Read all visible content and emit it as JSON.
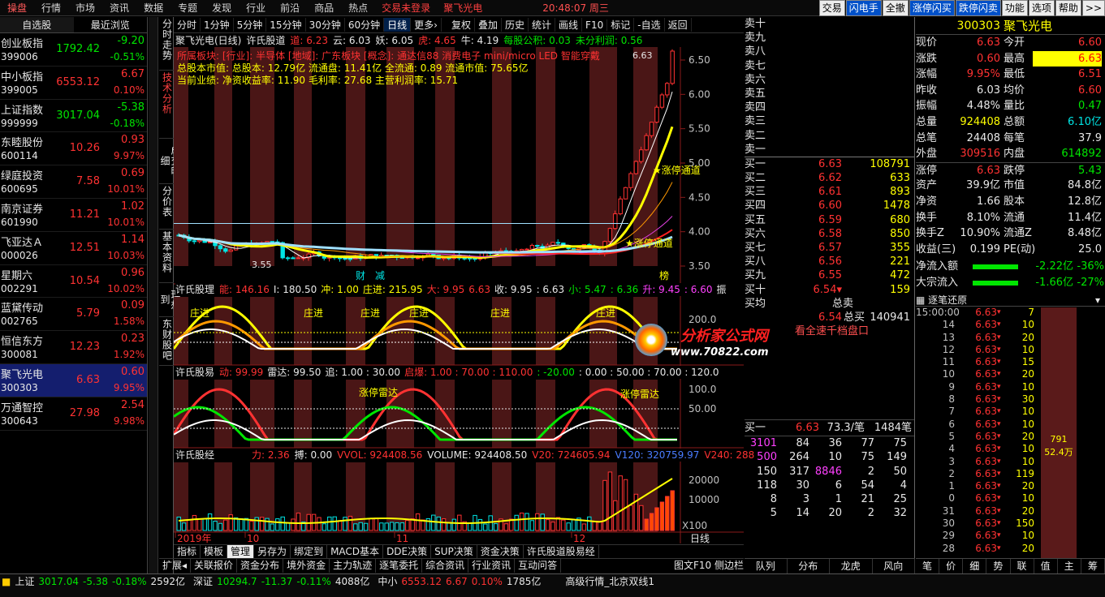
{
  "menu": {
    "items": [
      "操盘",
      "行情",
      "市场",
      "资讯",
      "数据",
      "专题",
      "发现",
      "行业",
      "前沿",
      "商品",
      "热点"
    ],
    "warning": "交易未登录",
    "stock": "聚飞光电",
    "time": "20:48:07 周三",
    "buttons": [
      "交易",
      "闪电手",
      "全撤",
      "涨停闪买",
      "跌停闪卖",
      "功能",
      "选项",
      "帮助",
      ">>"
    ]
  },
  "watch": {
    "tabs": [
      "自选股",
      "最近浏览"
    ],
    "rows": [
      {
        "name": "创业板指",
        "code": "399006",
        "price": "1792.42",
        "chg": "-9.20",
        "pct": "-0.51%",
        "dir": "down"
      },
      {
        "name": "中小板指",
        "code": "399005",
        "price": "6553.12",
        "chg": "6.67",
        "pct": "0.10%",
        "dir": "up"
      },
      {
        "name": "上证指数",
        "code": "999999",
        "price": "3017.04",
        "chg": "-5.38",
        "pct": "-0.18%",
        "dir": "down"
      },
      {
        "name": "东睦股份",
        "code": "600114",
        "price": "10.26",
        "chg": "0.93",
        "pct": "9.97%",
        "dir": "up"
      },
      {
        "name": "绿庭投资",
        "code": "600695",
        "price": "7.58",
        "chg": "0.69",
        "pct": "10.01%",
        "dir": "up"
      },
      {
        "name": "南京证券",
        "code": "601990",
        "price": "11.21",
        "chg": "1.02",
        "pct": "10.01%",
        "dir": "up"
      },
      {
        "name": "飞亚达Ａ",
        "code": "000026",
        "price": "12.51",
        "chg": "1.14",
        "pct": "10.03%",
        "dir": "up"
      },
      {
        "name": "星期六",
        "code": "002291",
        "price": "10.54",
        "chg": "0.96",
        "pct": "10.02%",
        "dir": "up"
      },
      {
        "name": "蓝黛传动",
        "code": "002765",
        "price": "5.79",
        "chg": "0.09",
        "pct": "1.58%",
        "dir": "up"
      },
      {
        "name": "恒信东方",
        "code": "300081",
        "price": "12.23",
        "chg": "0.23",
        "pct": "1.92%",
        "dir": "up"
      },
      {
        "name": "聚飞光电",
        "code": "300303",
        "price": "6.63",
        "chg": "0.60",
        "pct": "9.95%",
        "dir": "up",
        "selected": true
      },
      {
        "name": "万通智控",
        "code": "300643",
        "price": "27.98",
        "chg": "2.54",
        "pct": "9.98%",
        "dir": "up"
      }
    ]
  },
  "vtabs": [
    "分时走势",
    "技术分析",
    "成交明细",
    "分价表",
    "基本资料",
    "理想到",
    "东财股吧"
  ],
  "period": {
    "items": [
      "分时",
      "1分钟",
      "5分钟",
      "15分钟",
      "30分钟",
      "60分钟",
      "日线",
      "更多›"
    ],
    "tools": [
      "复权",
      "叠加",
      "历史",
      "统计",
      "画线",
      "F10",
      "标记",
      "-自选",
      "返回"
    ]
  },
  "kline": {
    "title": "聚飞光电(日线)",
    "indicator": "许氏股道",
    "params": [
      {
        "t": "道: 6.23",
        "c": "red"
      },
      {
        "t": "云: 6.03",
        "c": "white"
      },
      {
        "t": "妖: 6.05",
        "c": "white"
      },
      {
        "t": "虎: 4.65",
        "c": "red"
      },
      {
        "t": "牛: 4.19",
        "c": "white"
      },
      {
        "t": "每股公积: 0.03",
        "c": "green"
      },
      {
        "t": "未分利润: 0.56",
        "c": "green"
      }
    ],
    "info1": "所属板块: [行业]: 半导体 [地域]: 广东板块 [概念]: 通达信88 消费电子 mini/micro LED 智能穿戴",
    "info2": "总股本市值: 总股本: 12.79亿 流通盘: 11.41亿 全流通: 0.89 流通市值: 75.65亿",
    "info3": "当前业绩: 净资收益率: 11.90 毛利率: 27.68 主营利润率: 15.71",
    "yticks": [
      "6.50",
      "6.00",
      "5.50",
      "5.00",
      "4.50",
      "4.00",
      "3.50"
    ],
    "high_label": "6.63",
    "low_label": "3.55",
    "annot1": "★涨停通道",
    "annot2": "★涨停通道",
    "m1": "财",
    "m2": "减",
    "m3": "榜"
  },
  "ind1": {
    "title": "许氏股理",
    "params": [
      {
        "t": "能: 146.16",
        "c": "red"
      },
      {
        "t": "I: 180.50",
        "c": "white"
      },
      {
        "t": "冲: 1.00",
        "c": "yellow"
      },
      {
        "t": "庄进: 215.95",
        "c": "yellow"
      },
      {
        "t": "大: 9.95",
        "c": "red"
      },
      {
        "t": "6.63",
        "c": "red"
      },
      {
        "t": "收: 9.95",
        "c": "white"
      },
      {
        "t": ": 6.63",
        "c": "white"
      },
      {
        "t": "小: 5.47",
        "c": "green"
      },
      {
        "t": ": 6.36",
        "c": "green"
      },
      {
        "t": "升: 9.45",
        "c": "mag"
      },
      {
        "t": ": 6.60",
        "c": "mag"
      },
      {
        "t": "振",
        "c": "white"
      }
    ],
    "label": "庄进",
    "ytick": "200.0"
  },
  "ind2": {
    "title": "许氏股易",
    "params": [
      {
        "t": "动: 99.99",
        "c": "red"
      },
      {
        "t": "雷达: 99.50",
        "c": "white"
      },
      {
        "t": "追: 1.00 : 30.00",
        "c": "white"
      },
      {
        "t": "启爆: 1.00 : 70.00 : 110.00",
        "c": "red"
      },
      {
        "t": ": -20.00",
        "c": "green"
      },
      {
        "t": ": 0.00 : 50.00 : 70.00 : 120.0",
        "c": "white"
      }
    ],
    "label": "涨停雷达",
    "yticks": [
      "100.0",
      "50.00"
    ]
  },
  "ind3": {
    "title": "许氏股经",
    "params": [
      {
        "t": "力: 2.36",
        "c": "red"
      },
      {
        "t": "搏: 0.00",
        "c": "white"
      },
      {
        "t": "VVOL: 924408.56",
        "c": "red"
      },
      {
        "t": "VOLUME: 924408.50",
        "c": "white"
      },
      {
        "t": "V20: 724605.94",
        "c": "red"
      },
      {
        "t": "V120: 320759.97",
        "c": "blue"
      },
      {
        "t": "V240: 288",
        "c": "red"
      }
    ],
    "yticks": [
      "20000",
      "10000"
    ],
    "unit": "X100",
    "xlabels": [
      "2019年",
      "10",
      "11",
      "12"
    ],
    "period_label": "日线"
  },
  "bottom_tabs": [
    "指标",
    "模板",
    "管理",
    "另存为",
    "绑定到",
    "MACD基本",
    "DDE决策",
    "SUP决策",
    "资金决策",
    "许氏股道股易经"
  ],
  "bottom_tabs2": [
    "扩展◂",
    "关联报价",
    "资金分布",
    "境外资金",
    "主力轨迹",
    "逐笔委托",
    "综合资讯",
    "行业资讯",
    "互动问答"
  ],
  "bottom_right": "图文F10 侧边栏",
  "orderbook": {
    "sells": [
      "卖十",
      "卖九",
      "卖八",
      "卖七",
      "卖六",
      "卖五",
      "卖四",
      "卖三",
      "卖二",
      "卖一"
    ],
    "buys": [
      {
        "l": "买一",
        "p": "6.63",
        "v": "108791"
      },
      {
        "l": "买二",
        "p": "6.62",
        "v": "633"
      },
      {
        "l": "买三",
        "p": "6.61",
        "v": "893"
      },
      {
        "l": "买四",
        "p": "6.60",
        "v": "1478"
      },
      {
        "l": "买五",
        "p": "6.59",
        "v": "680"
      },
      {
        "l": "买六",
        "p": "6.58",
        "v": "850"
      },
      {
        "l": "买七",
        "p": "6.57",
        "v": "355"
      },
      {
        "l": "买八",
        "p": "6.56",
        "v": "221"
      },
      {
        "l": "买九",
        "p": "6.55",
        "v": "472"
      },
      {
        "l": "买十",
        "p": "6.54▾",
        "v": "159"
      }
    ],
    "total_sell_label": "总卖",
    "avg_label": "买均",
    "avg_price": "6.54",
    "total_buy_label": "总买",
    "total_buy": "140941",
    "link": "看全速千档盘口",
    "logo_title": "分析家公式网",
    "logo_url": "www.70822.com",
    "queue": {
      "label": "买一",
      "price": "6.63",
      "per": "73.3/笔",
      "count": "1484笔"
    },
    "queue_rows": [
      [
        "3101",
        "84",
        "36",
        "77",
        "75"
      ],
      [
        "500",
        "264",
        "10",
        "75",
        "149"
      ],
      [
        "150",
        "317",
        "8846",
        "2",
        "50"
      ],
      [
        "118",
        "30",
        "6",
        "54",
        "4"
      ],
      [
        "8",
        "3",
        "1",
        "21",
        "25"
      ],
      [
        "5",
        "14",
        "20",
        "2",
        "32"
      ]
    ],
    "bottom_tabs": [
      "队列",
      "分布",
      "龙虎",
      "风向"
    ]
  },
  "quote": {
    "code": "300303",
    "name": "聚飞光电",
    "rows": [
      {
        "k": "现价",
        "v1": "6.63",
        "c1": "red",
        "k2": "今开",
        "v2": "6.60",
        "c2": "red"
      },
      {
        "k": "涨跌",
        "v1": "0.60",
        "c1": "red",
        "k2": "最高",
        "v2": "6.63",
        "c2": "red",
        "box": true
      },
      {
        "k": "涨幅",
        "v1": "9.95%",
        "c1": "red",
        "k2": "最低",
        "v2": "6.51",
        "c2": "red"
      },
      {
        "k": "昨收",
        "v1": "6.03",
        "c1": "white",
        "k2": "均价",
        "v2": "6.60",
        "c2": "red"
      },
      {
        "k": "振幅",
        "v1": "4.48%",
        "c1": "white",
        "k2": "量比",
        "v2": "0.47",
        "c2": "green"
      },
      {
        "k": "总量",
        "v1": "924408",
        "c1": "yellow",
        "k2": "总额",
        "v2": "6.10亿",
        "c2": "cyan"
      },
      {
        "k": "总笔",
        "v1": "24408",
        "c1": "white",
        "k2": "每笔",
        "v2": "37.9",
        "c2": "white"
      },
      {
        "k": "外盘",
        "v1": "309516",
        "c1": "red",
        "k2": "内盘",
        "v2": "614892",
        "c2": "green"
      },
      {
        "k": "涨停",
        "v1": "6.63",
        "c1": "red",
        "k2": "跌停",
        "v2": "5.43",
        "c2": "green"
      },
      {
        "k": "资产",
        "v1": "39.9亿",
        "c1": "white",
        "k2": "市值",
        "v2": "84.8亿",
        "c2": "white"
      },
      {
        "k": "净资",
        "v1": "1.66",
        "c1": "white",
        "k2": "股本",
        "v2": "12.8亿",
        "c2": "white"
      },
      {
        "k": "换手",
        "v1": "8.10%",
        "c1": "white",
        "k2": "流通",
        "v2": "11.4亿",
        "c2": "white"
      },
      {
        "k": "换手Z",
        "v1": "10.90%",
        "c1": "white",
        "k2": "流通Z",
        "v2": "8.48亿",
        "c2": "white"
      },
      {
        "k": "收益(三)",
        "v1": "0.199",
        "c1": "white",
        "k2": "PE(动)",
        "v2": "25.0",
        "c2": "white"
      }
    ],
    "flow1": {
      "label": "净流入额",
      "value": "-2.22亿",
      "pct": "-36%"
    },
    "flow2": {
      "label": "大宗流入",
      "value": "-1.66亿",
      "pct": "-27%"
    },
    "ticks_title": "逐笔还原",
    "ticks": [
      {
        "t": "15:00:00",
        "p": "6.63",
        "v": "7"
      },
      {
        "t": "14",
        "p": "6.63",
        "v": "10"
      },
      {
        "t": "13",
        "p": "6.63",
        "v": "20"
      },
      {
        "t": "12",
        "p": "6.63",
        "v": "10"
      },
      {
        "t": "11",
        "p": "6.63",
        "v": "15"
      },
      {
        "t": "10",
        "p": "6.63",
        "v": "20"
      },
      {
        "t": "9",
        "p": "6.63",
        "v": "10"
      },
      {
        "t": "8",
        "p": "6.63",
        "v": "30"
      },
      {
        "t": "7",
        "p": "6.63",
        "v": "10"
      },
      {
        "t": "6",
        "p": "6.63",
        "v": "10"
      },
      {
        "t": "5",
        "p": "6.63",
        "v": "20"
      },
      {
        "t": "4",
        "p": "6.63",
        "v": "10"
      },
      {
        "t": "3",
        "p": "6.63",
        "v": "10"
      },
      {
        "t": "2",
        "p": "6.63",
        "v": "119"
      },
      {
        "t": "1",
        "p": "6.63",
        "v": "20"
      },
      {
        "t": "0",
        "p": "6.63",
        "v": "10"
      },
      {
        "t": "31",
        "p": "6.63",
        "v": "20"
      },
      {
        "t": "30",
        "p": "6.63",
        "v": "150"
      },
      {
        "t": "29",
        "p": "6.63",
        "v": "10"
      },
      {
        "t": "28",
        "p": "6.63",
        "v": "20"
      }
    ],
    "agg_vol": "791",
    "agg_amt": "52.4万",
    "bottom_tabs": [
      "笔",
      "价",
      "细",
      "势",
      "联",
      "值",
      "主",
      "筹"
    ]
  },
  "status": {
    "items": [
      {
        "n": "上证",
        "v": "3017.04",
        "c": "-5.38",
        "p": "-0.18%",
        "a": "2592亿",
        "dir": "down"
      },
      {
        "n": "深证",
        "v": "10294.7",
        "c": "-11.37",
        "p": "-0.11%",
        "a": "4088亿",
        "dir": "down"
      },
      {
        "n": "中小",
        "v": "6553.12",
        "c": "6.67",
        "p": "0.10%",
        "a": "1785亿",
        "dir": "up"
      }
    ],
    "msg": "高级行情_北京双线1",
    "time": "20:48"
  },
  "colors": {
    "up": "#ff3232",
    "down": "#00e600",
    "bg": "#000000",
    "shade": "#5a1a1a"
  }
}
